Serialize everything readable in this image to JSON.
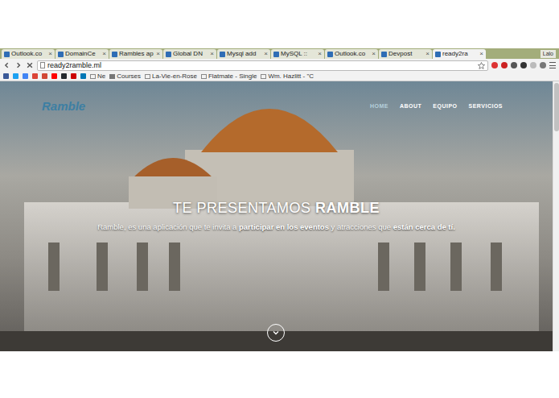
{
  "tabs": [
    {
      "label": "Outlook.co",
      "selected": false
    },
    {
      "label": "DomainCe",
      "selected": false
    },
    {
      "label": "Rambles ap",
      "selected": false
    },
    {
      "label": "Global DN",
      "selected": false
    },
    {
      "label": "Mysql add",
      "selected": false
    },
    {
      "label": "MySQL ::",
      "selected": false
    },
    {
      "label": "Outlook.co",
      "selected": false
    },
    {
      "label": "Devpost",
      "selected": false
    },
    {
      "label": "ready2ra",
      "selected": true
    }
  ],
  "profile": "Lalo",
  "address": "ready2ramble.ml",
  "bookmarks": {
    "favicons": [
      {
        "color": "#3b5998"
      },
      {
        "color": "#1da1f2"
      },
      {
        "color": "#4285f4"
      },
      {
        "color": "#db4437"
      },
      {
        "color": "#d14836"
      },
      {
        "color": "#ff0000"
      },
      {
        "color": "#24292e"
      },
      {
        "color": "#cc0000"
      },
      {
        "color": "#0077b5"
      }
    ],
    "items": [
      {
        "label": "Ne"
      },
      {
        "label": "Courses"
      },
      {
        "label": "La-Vie-en-Rose"
      },
      {
        "label": "Flatmate - Single"
      },
      {
        "label": "Wm. Hazlitt - \"C"
      }
    ]
  },
  "site": {
    "logo": "Ramble",
    "nav": [
      {
        "label": "HOME",
        "selected": true
      },
      {
        "label": "ABOUT",
        "selected": false
      },
      {
        "label": "EQUIPO",
        "selected": false
      },
      {
        "label": "SERVICIOS",
        "selected": false
      }
    ],
    "headline": [
      {
        "text": "TE PRESENTAMOS ",
        "bold": false
      },
      {
        "text": "RAMBLE",
        "bold": true
      }
    ],
    "tagline": [
      {
        "text": "Ramble, es una aplicación que te invita a ",
        "bold": false
      },
      {
        "text": "participar en los eventos",
        "bold": true
      },
      {
        "text": " y atracciones que ",
        "bold": false
      },
      {
        "text": "están cerca de tí.",
        "bold": true
      }
    ]
  }
}
